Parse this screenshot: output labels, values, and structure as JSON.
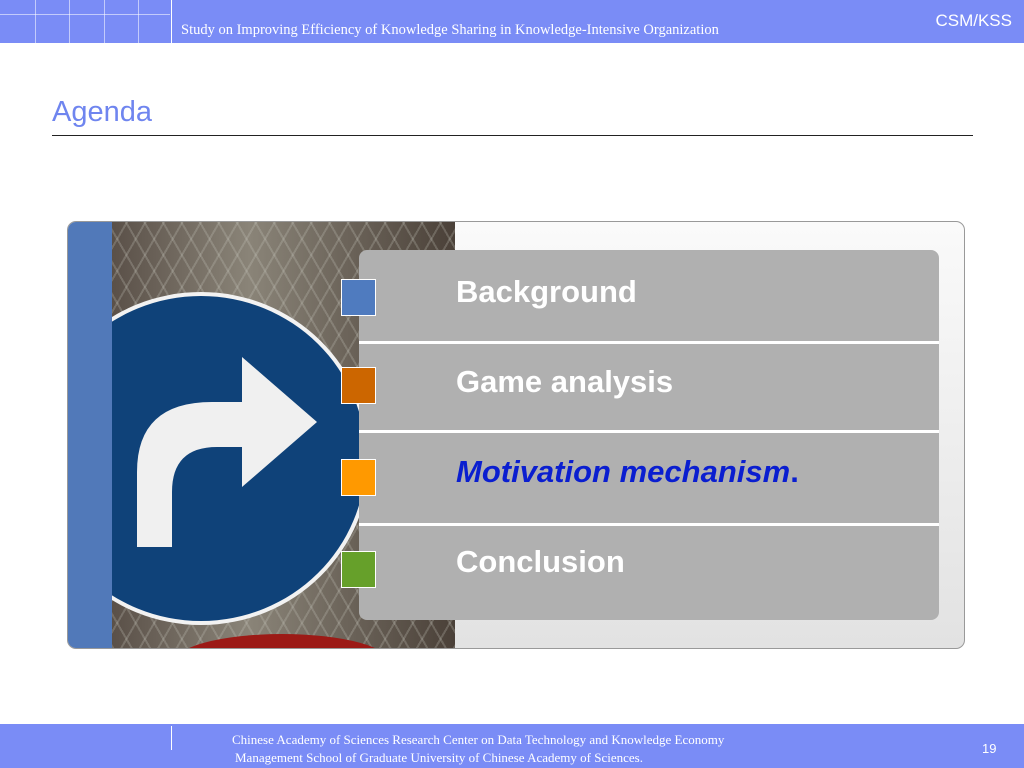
{
  "header": {
    "title": "Study on Improving Efficiency of Knowledge Sharing in Knowledge-Intensive Organization",
    "code": "CSM/KSS"
  },
  "slide": {
    "title": "Agenda"
  },
  "agenda": {
    "items": [
      {
        "label": "Background",
        "color": "#4f7bbf"
      },
      {
        "label": "Game analysis",
        "color": "#cc6600"
      },
      {
        "label": "Motivation mechanism",
        "suffix": ".",
        "color": "#ff9900",
        "active": true
      },
      {
        "label": "Conclusion",
        "color": "#66a02a"
      }
    ]
  },
  "footer": {
    "line1": "Chinese Academy of Sciences Research Center on Data Technology and Knowledge Economy",
    "line2": "Management School of Graduate University of Chinese Academy of Sciences.",
    "page": "19"
  }
}
